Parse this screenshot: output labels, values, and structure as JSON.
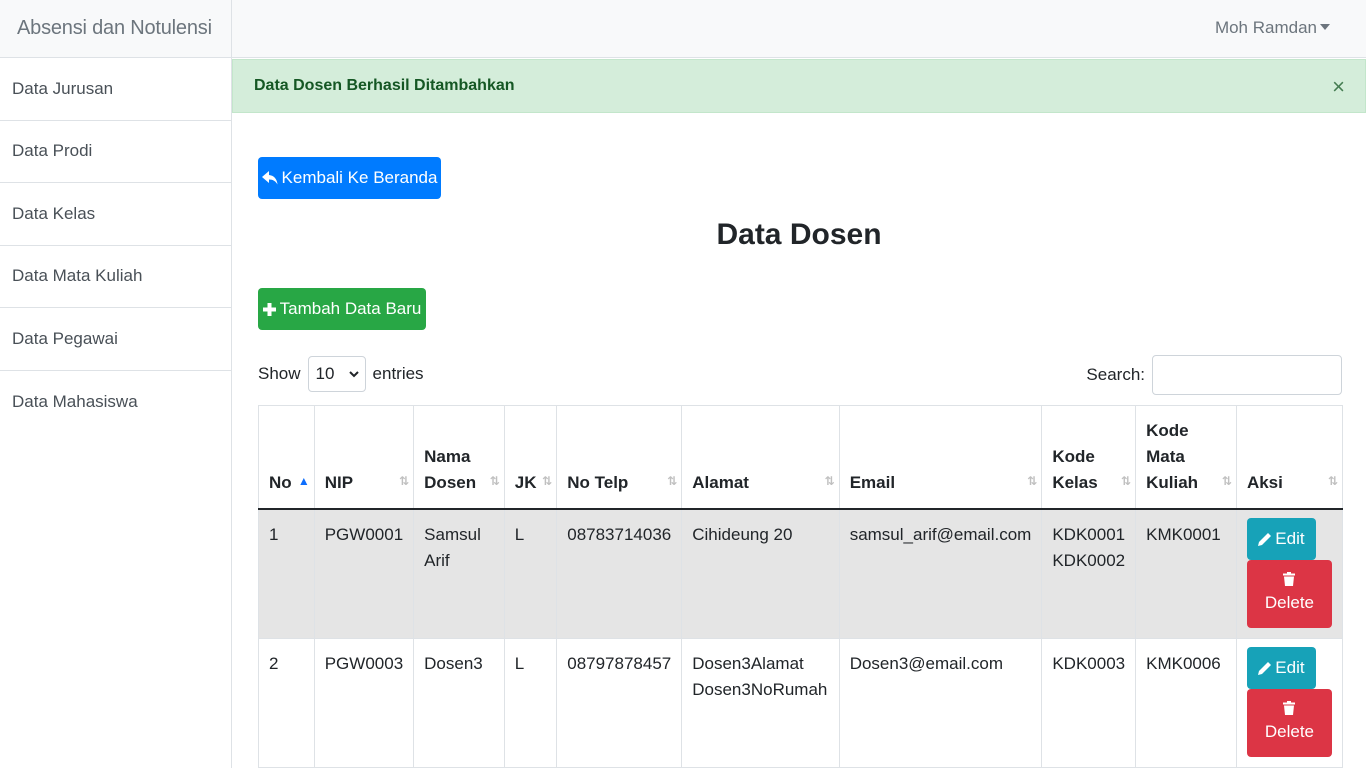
{
  "brand": "Absensi dan Notulensi",
  "sidebar": {
    "items": [
      {
        "label": "Data Jurusan"
      },
      {
        "label": "Data Prodi"
      },
      {
        "label": "Data Kelas"
      },
      {
        "label": "Data Mata Kuliah"
      },
      {
        "label": "Data Pegawai"
      },
      {
        "label": "Data Mahasiswa"
      }
    ]
  },
  "user": {
    "name": "Moh Ramdan"
  },
  "alert": {
    "text": "Data Dosen Berhasil Ditambahkan",
    "close": "×"
  },
  "buttons": {
    "back": "Kembali Ke Beranda",
    "add": "Tambah Data Baru",
    "edit": "Edit",
    "delete": "Delete"
  },
  "page": {
    "title": "Data Dosen"
  },
  "table_controls": {
    "show": "Show",
    "entries_value": "10",
    "entries": "entries",
    "search": "Search:"
  },
  "table": {
    "headers": [
      "No",
      "NIP",
      "Nama Dosen",
      "JK",
      "No Telp",
      "Alamat",
      "Email",
      "Kode Kelas",
      "Kode Mata Kuliah",
      "Aksi"
    ],
    "rows": [
      {
        "no": "1",
        "nip": "PGW0001",
        "nama": "Samsul Arif",
        "jk": "L",
        "telp": "08783714036",
        "alamat": [
          "Cihideung 20"
        ],
        "email": "samsul_arif@email.com",
        "kode_kelas": [
          "KDK0001",
          "KDK0002"
        ],
        "kode_mk": "KMK0001"
      },
      {
        "no": "2",
        "nip": "PGW0003",
        "nama": "Dosen3",
        "jk": "L",
        "telp": "08797878457",
        "alamat": [
          "Dosen3Alamat",
          "Dosen3NoRumah"
        ],
        "email": "Dosen3@email.com",
        "kode_kelas": [
          "KDK0003"
        ],
        "kode_mk": "KMK0006"
      }
    ]
  },
  "colors": {
    "primary": "#007bff",
    "success": "#28a745",
    "info": "#17a2b8",
    "danger": "#dc3545",
    "alert_bg": "#d4edda"
  }
}
